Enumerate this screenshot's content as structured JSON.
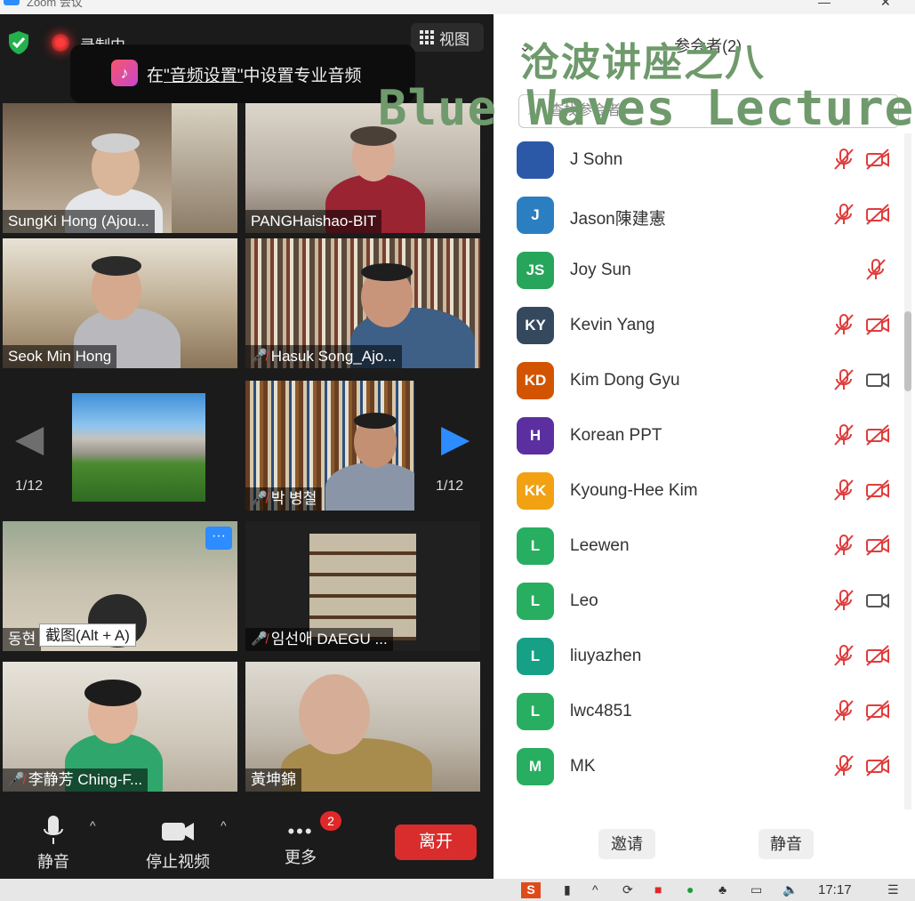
{
  "window": {
    "title": "Zoom 会议"
  },
  "topbar": {
    "recording_label": "录制中",
    "view_label": "视图"
  },
  "toast": {
    "prefix": "在",
    "link": "\"音频设置\"",
    "suffix": "中设置专业音频"
  },
  "tiles": [
    {
      "name": "SungKi Hong (Ajou...",
      "muted": false
    },
    {
      "name": "PANGHaishao-BIT",
      "muted": false
    },
    {
      "name": "Seok Min Hong",
      "muted": false
    },
    {
      "name": "Hasuk Song_Ajo...",
      "muted": true
    },
    {
      "name": "",
      "muted": false
    },
    {
      "name": "박 병철",
      "muted": true
    },
    {
      "name": "동현",
      "muted": false
    },
    {
      "name": "임선애 DAEGU ...",
      "muted": true
    },
    {
      "name": "李静芳 Ching-F...",
      "muted": true
    },
    {
      "name": "黃坤錦",
      "muted": false
    }
  ],
  "pagination": {
    "left": "1/12",
    "right": "1/12"
  },
  "tooltip": "截图(Alt + A)",
  "toolbar": {
    "mute": "静音",
    "stop_video": "停止视频",
    "more": "更多",
    "more_badge": "2",
    "leave": "离开"
  },
  "panel": {
    "title": "参会者(2)",
    "search_placeholder": "查找参会者",
    "watermark_line1": "沧波讲座之八",
    "watermark_line2": "Blue Waves Lecture",
    "invite": "邀请",
    "mute_all": "静音",
    "participants": [
      {
        "initials": "",
        "name": "J Sohn",
        "color": "#2c58a8",
        "cam": "off"
      },
      {
        "initials": "J",
        "name": "Jason陳建憲",
        "color": "#2b7fc1",
        "cam": "off"
      },
      {
        "initials": "JS",
        "name": "Joy Sun",
        "color": "#27a55a",
        "cam": "none"
      },
      {
        "initials": "KY",
        "name": "Kevin Yang",
        "color": "#34495e",
        "cam": "off"
      },
      {
        "initials": "KD",
        "name": "Kim Dong Gyu",
        "color": "#d35400",
        "cam": "on"
      },
      {
        "initials": "H",
        "name": "Korean PPT",
        "color": "#5b2fa0",
        "cam": "off"
      },
      {
        "initials": "KK",
        "name": "Kyoung-Hee Kim",
        "color": "#f1a112",
        "cam": "off"
      },
      {
        "initials": "L",
        "name": "Leewen",
        "color": "#27ae60",
        "cam": "off"
      },
      {
        "initials": "L",
        "name": "Leo",
        "color": "#27ae60",
        "cam": "on"
      },
      {
        "initials": "L",
        "name": "liuyazhen",
        "color": "#16a085",
        "cam": "off"
      },
      {
        "initials": "L",
        "name": "lwc4851",
        "color": "#27ae60",
        "cam": "off"
      },
      {
        "initials": "M",
        "name": "MK",
        "color": "#27ae60",
        "cam": "off"
      }
    ]
  },
  "taskbar": {
    "time": "17:17"
  }
}
